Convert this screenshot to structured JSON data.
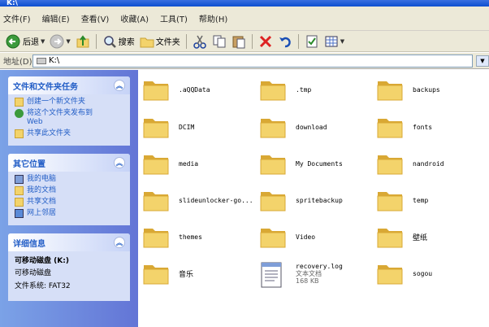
{
  "window": {
    "title": "K:\\"
  },
  "menu": [
    {
      "key": "file",
      "label": "文件(F)"
    },
    {
      "key": "edit",
      "label": "编辑(E)"
    },
    {
      "key": "view",
      "label": "查看(V)"
    },
    {
      "key": "favorites",
      "label": "收藏(A)"
    },
    {
      "key": "tools",
      "label": "工具(T)"
    },
    {
      "key": "help",
      "label": "帮助(H)"
    }
  ],
  "toolbar": {
    "back_label": "后退",
    "search_label": "搜索",
    "folders_label": "文件夹"
  },
  "address": {
    "label": "地址(D)",
    "path": "K:\\"
  },
  "taskpane": {
    "file_tasks": {
      "title": "文件和文件夹任务",
      "items": [
        "创建一个新文件夹",
        "将这个文件夹发布到",
        "Web",
        "共享此文件夹"
      ]
    },
    "other_places": {
      "title": "其它位置",
      "items": [
        "我的电脑",
        "我的文档",
        "共享文档",
        "网上邻居"
      ]
    },
    "details": {
      "title": "详细信息",
      "name": "可移动磁盘 (K:)",
      "type": "可移动磁盘",
      "fs": "文件系统: FAT32"
    }
  },
  "files": [
    {
      "name": ".aQQData",
      "kind": "folder"
    },
    {
      "name": ".tmp",
      "kind": "folder"
    },
    {
      "name": "backups",
      "kind": "folder"
    },
    {
      "name": "DCIM",
      "kind": "folder"
    },
    {
      "name": "download",
      "kind": "folder"
    },
    {
      "name": "fonts",
      "kind": "folder"
    },
    {
      "name": "media",
      "kind": "folder"
    },
    {
      "name": "My Documents",
      "kind": "folder"
    },
    {
      "name": "nandroid",
      "kind": "folder"
    },
    {
      "name": "slideunlocker-go...",
      "kind": "folder"
    },
    {
      "name": "spritebackup",
      "kind": "folder"
    },
    {
      "name": "temp",
      "kind": "folder"
    },
    {
      "name": "themes",
      "kind": "folder"
    },
    {
      "name": "Video",
      "kind": "folder"
    },
    {
      "name": "壁纸",
      "kind": "folder"
    },
    {
      "name": "音乐",
      "kind": "folder"
    },
    {
      "name": "recovery.log",
      "kind": "file",
      "type": "文本文档",
      "size": "168 KB"
    },
    {
      "name": "sogou",
      "kind": "folder"
    }
  ],
  "colors": {
    "folder": "#f3d36b",
    "folder_dark": "#d9a834",
    "taskpane_link": "#215dc6",
    "taskpane_bg": "#6375d6"
  }
}
